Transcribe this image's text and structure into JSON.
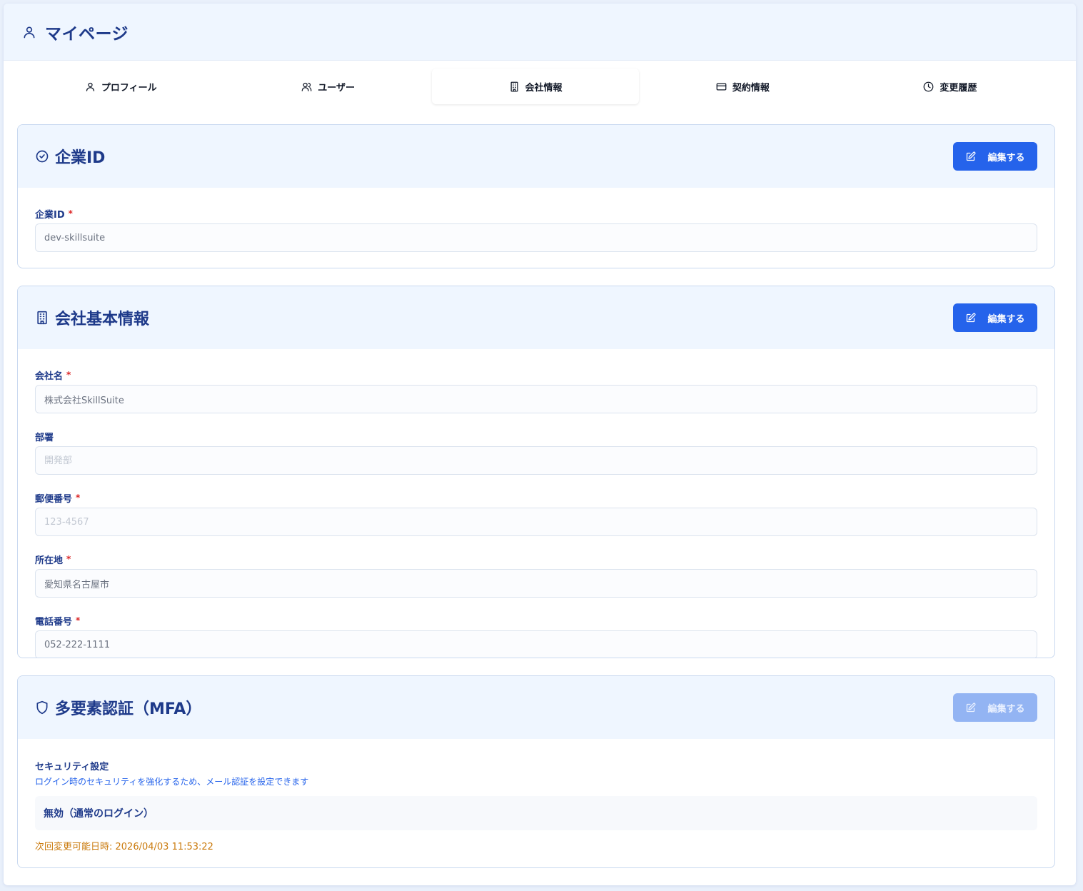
{
  "header": {
    "title": "マイページ",
    "icon": "user-icon"
  },
  "tabs": [
    {
      "label": "プロフィール",
      "icon": "user-icon",
      "active": false
    },
    {
      "label": "ユーザー",
      "icon": "users-icon",
      "active": false
    },
    {
      "label": "会社情報",
      "icon": "building-icon",
      "active": true
    },
    {
      "label": "契約情報",
      "icon": "credit-card-icon",
      "active": false
    },
    {
      "label": "変更履歴",
      "icon": "clock-icon",
      "active": false
    }
  ],
  "edit_label": "編集する",
  "required_mark": "*",
  "company_id_section": {
    "title": "企業ID",
    "icon": "badge-check-icon",
    "fields": [
      {
        "label": "企業ID",
        "value": "dev-skillsuite",
        "required": true
      }
    ]
  },
  "company_info_section": {
    "title": "会社基本情報",
    "icon": "building-icon",
    "fields": [
      {
        "label": "会社名",
        "value": "株式会社SkillSuite",
        "placeholder": "",
        "required": true
      },
      {
        "label": "部署",
        "value": "",
        "placeholder": "開発部",
        "required": false
      },
      {
        "label": "郵便番号",
        "value": "",
        "placeholder": "123-4567",
        "required": true
      },
      {
        "label": "所在地",
        "value": "愛知県名古屋市",
        "placeholder": "",
        "required": true
      },
      {
        "label": "電話番号",
        "value": "052-222-1111",
        "placeholder": "",
        "required": true
      }
    ]
  },
  "mfa_section": {
    "title": "多要素認証（MFA）",
    "icon": "shield-icon",
    "edit_disabled": true,
    "security_label": "セキュリティ設定",
    "security_desc": "ログイン時のセキュリティを強化するため、メール認証を設定できます",
    "status": "無効（通常のログイン）",
    "next_change": "次回変更可能日時: 2026/04/03 11:53:22"
  },
  "colors": {
    "primary": "#2563eb",
    "primary_disabled": "#93b4f3",
    "heading": "#1e3a8a",
    "required": "#dc2626",
    "warning": "#ca7a0c"
  }
}
